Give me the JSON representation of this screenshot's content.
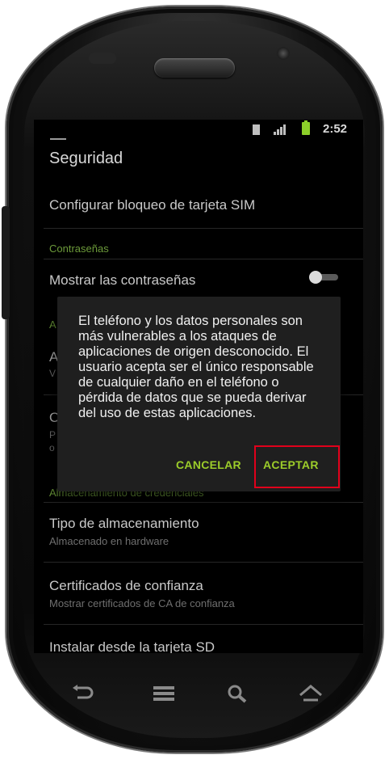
{
  "status_bar": {
    "time": "2:52"
  },
  "screen": {
    "title": "Seguridad",
    "sim_lock": "Configurar bloqueo de tarjeta SIM",
    "section_passwords": "Contraseñas",
    "show_passwords": "Mostrar las contraseñas",
    "show_passwords_on": false,
    "hidden_section_letter": "A",
    "hidden_row1_letter": "A",
    "hidden_row1_sub_letter": "V",
    "hidden_row2_letter": "O",
    "hidden_row2_sub_letter1": "P",
    "hidden_row2_sub_letter2": "o",
    "section_credentials": "Almacenamiento de credenciales",
    "storage_type": "Tipo de almacenamiento",
    "storage_type_sub": "Almacenado en hardware",
    "trusted_certs": "Certificados de confianza",
    "trusted_certs_sub": "Mostrar certificados de CA de confianza",
    "install_sd": "Instalar desde la tarjeta SD"
  },
  "dialog": {
    "message": "El teléfono y los datos personales son más vulnerables a los ataques de aplicaciones de origen desconocido. El usuario acepta ser el único responsable de cualquier daño en el teléfono o pérdida de datos que se pueda derivar del uso de estas aplicaciones.",
    "cancel": "CANCELAR",
    "accept": "ACEPTAR"
  },
  "colors": {
    "accent": "#9ccd2a",
    "highlight": "#e0001b",
    "section": "#6c9a3a"
  },
  "nav_icons": [
    "back-icon",
    "menu-icon",
    "search-icon",
    "home-icon"
  ]
}
